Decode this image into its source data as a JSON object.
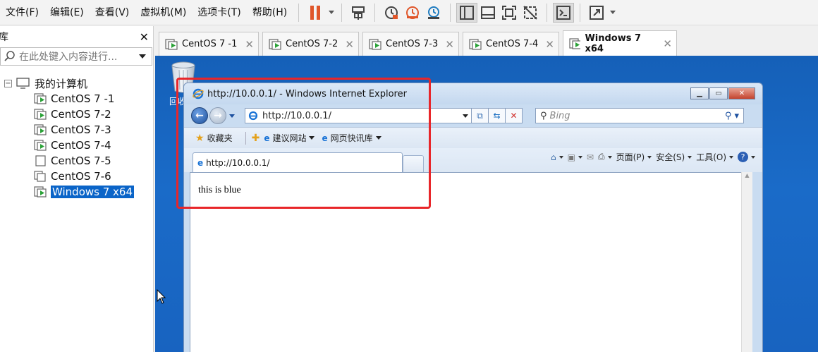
{
  "menu": {
    "items": [
      "文件(F)",
      "编辑(E)",
      "查看(V)",
      "虚拟机(M)",
      "选项卡(T)",
      "帮助(H)"
    ]
  },
  "toolbar": {
    "icons": [
      "pause-icon",
      "send-keys-icon",
      "snapshot-icon",
      "revert-snapshot-icon",
      "snapshot-manager-icon",
      "library-view-icon",
      "console-view-icon",
      "fullscreen-icon",
      "unity-icon",
      "terminal-icon",
      "stretch-icon"
    ],
    "accent": "#e0562a"
  },
  "library": {
    "title": "库",
    "search_placeholder": "在此处键入内容进行...",
    "root_label": "我的计算机",
    "items": [
      {
        "label": "CentOS 7 -1",
        "state": "running"
      },
      {
        "label": "CentOS 7-2",
        "state": "running"
      },
      {
        "label": "CentOS 7-3",
        "state": "running"
      },
      {
        "label": "CentOS 7-4",
        "state": "running"
      },
      {
        "label": "CentOS 7-5",
        "state": "off"
      },
      {
        "label": "CentOS 7-6",
        "state": "linked"
      },
      {
        "label": "Windows 7 x64",
        "state": "running",
        "selected": true
      }
    ]
  },
  "tabs": [
    {
      "label": "CentOS 7 -1"
    },
    {
      "label": "CentOS 7-2"
    },
    {
      "label": "CentOS 7-3"
    },
    {
      "label": "CentOS 7-4"
    },
    {
      "label": "Windows 7 x64",
      "active": true
    }
  ],
  "desktop": {
    "recycle_label": "回收"
  },
  "ie": {
    "title": "http://10.0.0.1/ - Windows Internet Explorer",
    "address": "http://10.0.0.1/",
    "search_placeholder": "Bing",
    "favorites_label": "收藏夹",
    "fav_links": [
      "建议网站",
      "网页快讯库"
    ],
    "tab_label": "http://10.0.0.1/",
    "commands": [
      "页面(P)",
      "安全(S)",
      "工具(O)"
    ],
    "page_text": "this is blue"
  },
  "annotation_color": "#e8262a"
}
